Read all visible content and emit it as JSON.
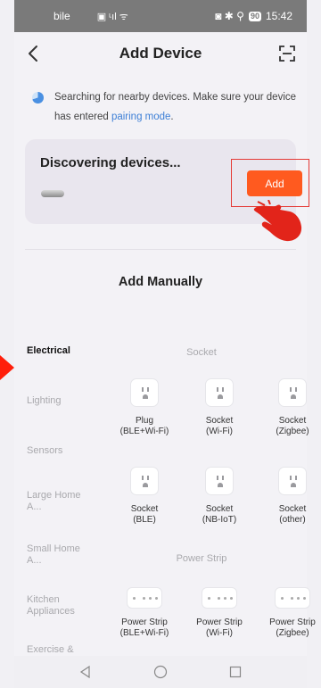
{
  "status_bar": {
    "carrier": "bile",
    "left_icons": "▣ ᶫıl ᯤ",
    "right_icons": "◙ ✱ ⚲",
    "battery": "90",
    "time": "15:42"
  },
  "header": {
    "title": "Add Device",
    "back_icon": "chevron-left-icon",
    "scan_icon": "scan-icon"
  },
  "search_hint": {
    "text": "Searching for nearby devices. Make sure your device has entered ",
    "link": "pairing mode",
    "suffix": "."
  },
  "discover": {
    "title": "Discovering devices...",
    "add_label": "Add"
  },
  "manual": {
    "title": "Add Manually",
    "categories": [
      {
        "label": "Electrical",
        "active": true
      },
      {
        "label": "Lighting",
        "active": false
      },
      {
        "label": "Sensors",
        "active": false
      },
      {
        "label": "Large Home A...",
        "active": false
      },
      {
        "label": "Small Home A...",
        "active": false
      },
      {
        "label": "Kitchen Appliances",
        "active": false
      },
      {
        "label": "Exercise &",
        "active": false
      }
    ],
    "groups": {
      "socket": "Socket",
      "power_strip": "Power Strip"
    },
    "sockets": [
      {
        "line1": "Plug",
        "line2": "(BLE+Wi-Fi)"
      },
      {
        "line1": "Socket",
        "line2": "(Wi-Fi)"
      },
      {
        "line1": "Socket",
        "line2": "(Zigbee)"
      },
      {
        "line1": "Socket",
        "line2": "(BLE)"
      },
      {
        "line1": "Socket",
        "line2": "(NB-IoT)"
      },
      {
        "line1": "Socket",
        "line2": "(other)"
      }
    ],
    "power_strips": [
      {
        "line1": "Power Strip",
        "line2": "(BLE+Wi-Fi)"
      },
      {
        "line1": "Power Strip",
        "line2": "(Wi-Fi)"
      },
      {
        "line1": "Power Strip",
        "line2": "(Zigbee)"
      }
    ]
  },
  "nav": {
    "back": "triangle-back-icon",
    "home": "circle-home-icon",
    "recents": "square-recents-icon"
  },
  "colors": {
    "accent": "#ff5a1f",
    "link": "#3d7fd6",
    "highlight": "#e53935"
  }
}
